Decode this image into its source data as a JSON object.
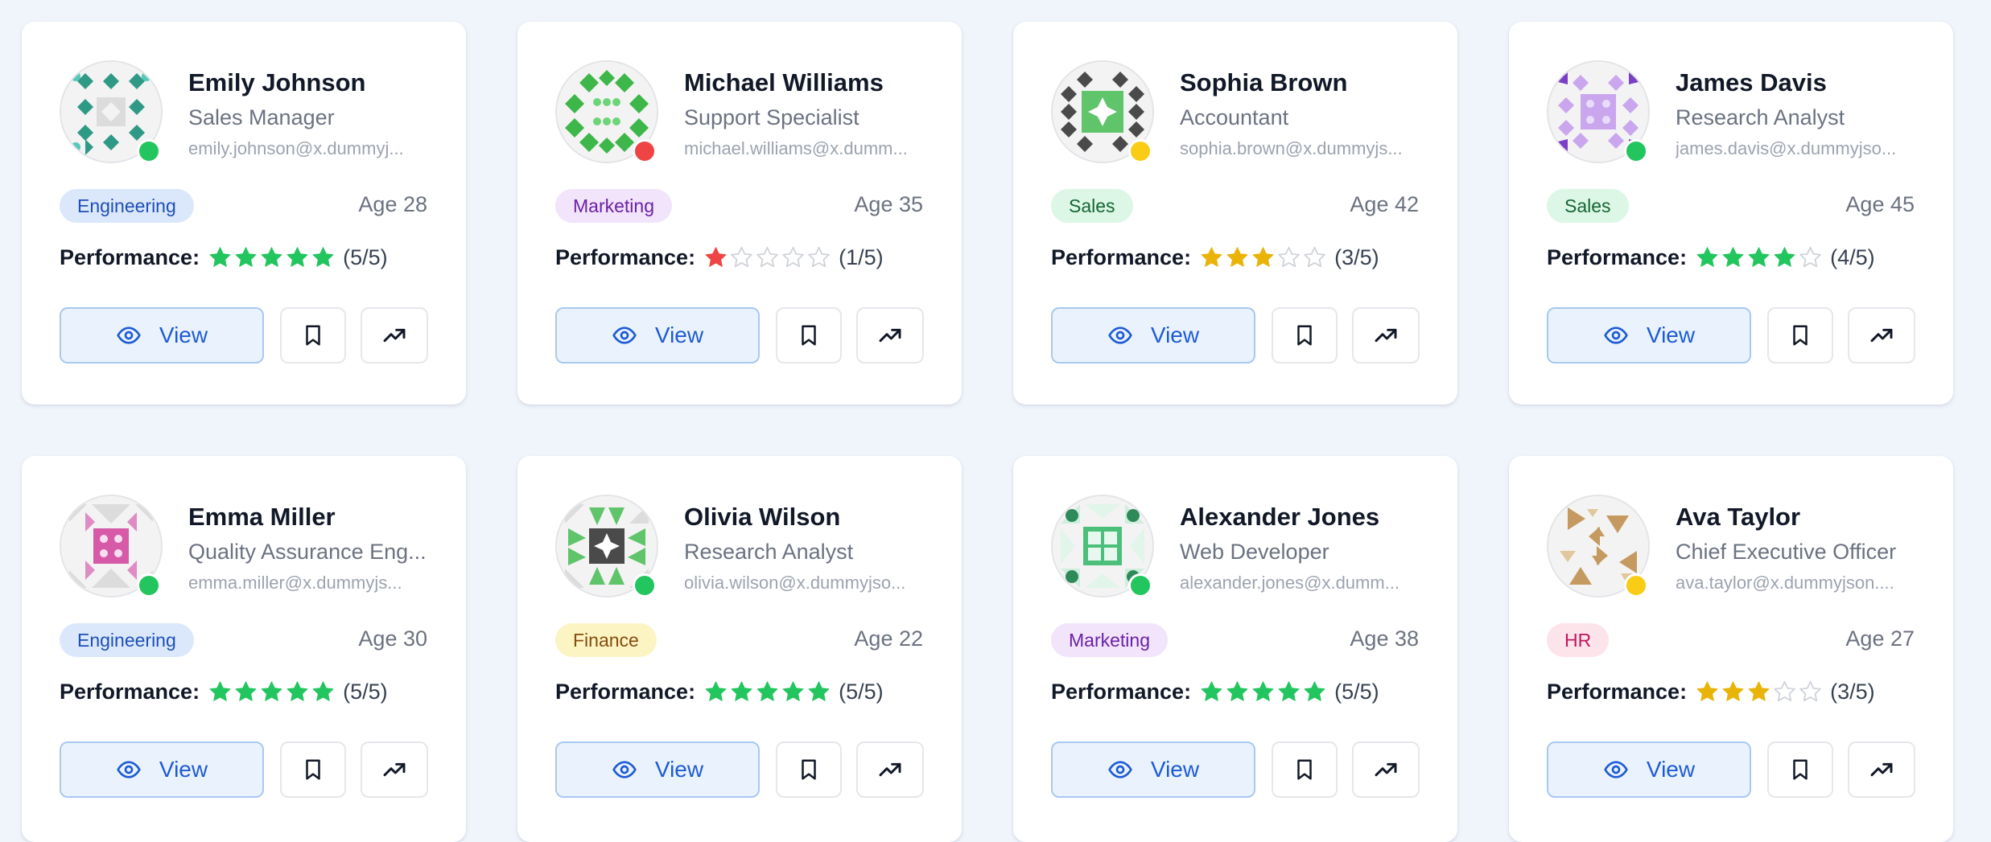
{
  "ui": {
    "view_label": "View",
    "performance_label": "Performance:"
  },
  "users": [
    {
      "name": "Emily Johnson",
      "title": "Sales Manager",
      "email": "emily.johnson@x.dummyj...",
      "department": "Engineering",
      "age": "Age 28",
      "rating": 5,
      "rating_text": "(5/5)",
      "status": "online",
      "avatar": {
        "icon": "identicon-teal-diamonds",
        "color": "#2e9a86"
      }
    },
    {
      "name": "Michael Williams",
      "title": "Support Specialist",
      "email": "michael.williams@x.dumm...",
      "department": "Marketing",
      "age": "Age 35",
      "rating": 1,
      "rating_text": "(1/5)",
      "status": "busy",
      "avatar": {
        "icon": "identicon-green-diamonds",
        "color": "#3db64a"
      }
    },
    {
      "name": "Sophia Brown",
      "title": "Accountant",
      "email": "sophia.brown@x.dummyjs...",
      "department": "Sales",
      "age": "Age 42",
      "rating": 3,
      "rating_text": "(3/5)",
      "status": "away",
      "avatar": {
        "icon": "identicon-dark-green",
        "color": "#4a4a4a"
      }
    },
    {
      "name": "James Davis",
      "title": "Research Analyst",
      "email": "james.davis@x.dummyjso...",
      "department": "Sales",
      "age": "Age 45",
      "rating": 4,
      "rating_text": "(4/5)",
      "status": "online",
      "avatar": {
        "icon": "identicon-purple",
        "color": "#9a6bd6"
      }
    },
    {
      "name": "Emma Miller",
      "title": "Quality Assurance Eng...",
      "email": "emma.miller@x.dummyjs...",
      "department": "Engineering",
      "age": "Age 30",
      "rating": 5,
      "rating_text": "(5/5)",
      "status": "online",
      "avatar": {
        "icon": "identicon-pink",
        "color": "#d65aa8"
      }
    },
    {
      "name": "Olivia Wilson",
      "title": "Research Analyst",
      "email": "olivia.wilson@x.dummyjso...",
      "department": "Finance",
      "age": "Age 22",
      "rating": 5,
      "rating_text": "(5/5)",
      "status": "online",
      "avatar": {
        "icon": "identicon-green-star",
        "color": "#3db64a"
      }
    },
    {
      "name": "Alexander Jones",
      "title": "Web Developer",
      "email": "alexander.jones@x.dumm...",
      "department": "Marketing",
      "age": "Age 38",
      "rating": 5,
      "rating_text": "(5/5)",
      "status": "online",
      "avatar": {
        "icon": "identicon-green-grid",
        "color": "#4cc07a"
      }
    },
    {
      "name": "Ava Taylor",
      "title": "Chief Executive Officer",
      "email": "ava.taylor@x.dummyjson....",
      "department": "HR",
      "age": "Age 27",
      "rating": 3,
      "rating_text": "(3/5)",
      "status": "away",
      "avatar": {
        "icon": "identicon-tan-pinwheel",
        "color": "#c59a60"
      }
    }
  ],
  "colors": {
    "status": {
      "online": "#22c55e",
      "busy": "#ef4444",
      "away": "#facc15"
    },
    "departments": {
      "Engineering": {
        "bg": "#dbe8fb",
        "fg": "#1e4fb8"
      },
      "Marketing": {
        "bg": "#f1e4fb",
        "fg": "#6b21a8"
      },
      "Sales": {
        "bg": "#dcf7e5",
        "fg": "#166534"
      },
      "Finance": {
        "bg": "#fdf4c4",
        "fg": "#854d0e"
      },
      "HR": {
        "bg": "#fde4ea",
        "fg": "#be185d"
      }
    },
    "rating": {
      "5": "#22c55e",
      "4": "#22c55e",
      "3": "#eab308",
      "2": "#eab308",
      "1": "#ef4444",
      "empty": "#cfd3d9"
    }
  }
}
